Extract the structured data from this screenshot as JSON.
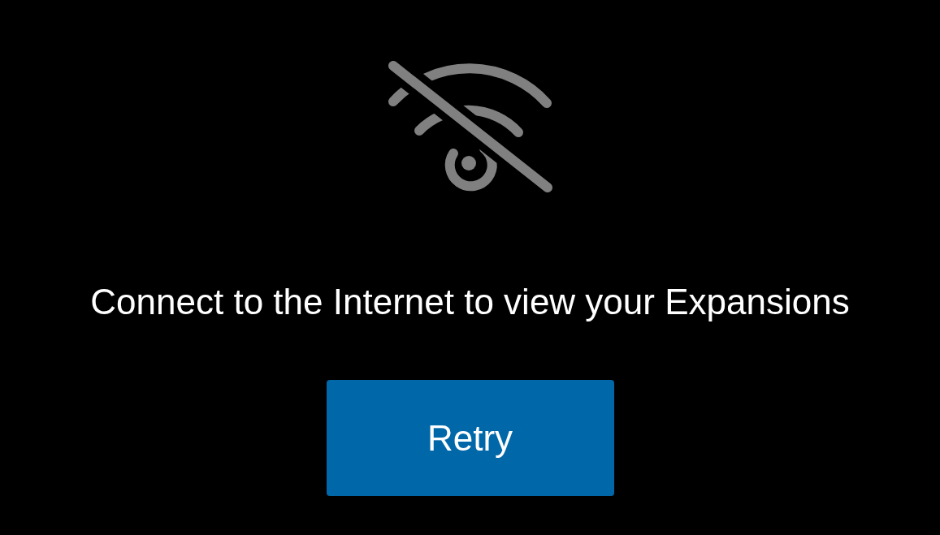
{
  "message": "Connect to the Internet to view your Expansions",
  "button": {
    "label": "Retry"
  }
}
